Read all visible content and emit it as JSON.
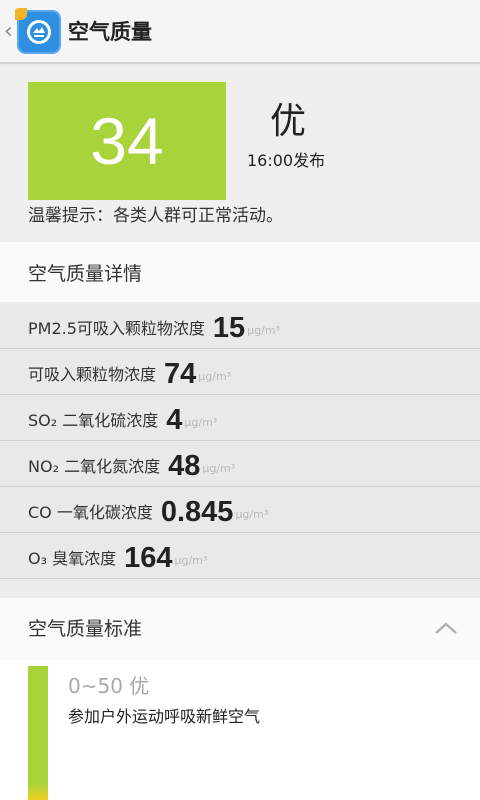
{
  "actionbar": {
    "back_glyph": "‹",
    "title": "空气质量",
    "icon": "app-logo-icon"
  },
  "summary": {
    "aqi": "34",
    "aqi_color": "#a9d33b",
    "level": "优",
    "time": "16:00发布",
    "tip": "温馨提示：各类人群可正常活动。"
  },
  "details": {
    "header": "空气质量详情",
    "rows": [
      {
        "name": "PM2.5可吸入颗粒物浓度",
        "value": "15",
        "unit": "μg/m³"
      },
      {
        "name": "可吸入颗粒物浓度",
        "value": "74",
        "unit": "μg/m³"
      },
      {
        "name": "SO₂ 二氧化硫浓度",
        "value": "4",
        "unit": "μg/m³"
      },
      {
        "name": "NO₂ 二氧化氮浓度",
        "value": "48",
        "unit": "μg/m³"
      },
      {
        "name": "CO 一氧化碳浓度",
        "value": "0.845",
        "unit": "μg/m³"
      },
      {
        "name": "O₃ 臭氧浓度",
        "value": "164",
        "unit": "μg/m³"
      }
    ]
  },
  "standard": {
    "header": "空气质量标准",
    "collapse_icon": "chevron-up-icon",
    "levels": [
      {
        "range": "0~50 优",
        "desc": "参加户外运动呼吸新鲜空气",
        "color": "#a9d33b"
      }
    ]
  }
}
